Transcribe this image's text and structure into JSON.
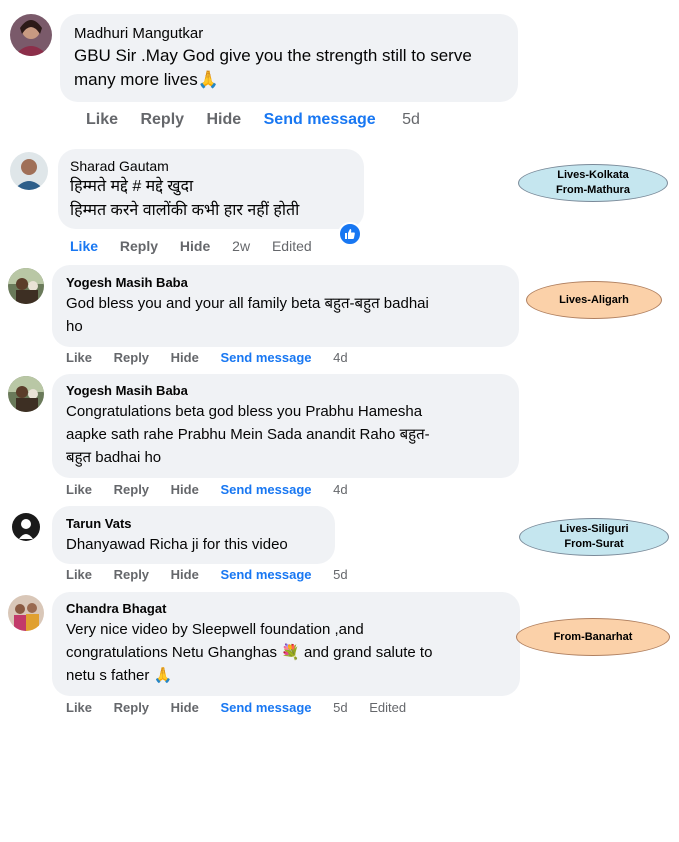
{
  "comments": [
    {
      "author": "Madhuri Mangutkar",
      "lines": [
        "GBU Sir .May God give you the strength still to serve",
        "many more lives🙏"
      ],
      "actions": {
        "like": "Like",
        "reply": "Reply",
        "hide": "Hide",
        "send": "Send message",
        "time": "5d"
      }
    },
    {
      "author": "Sharad Gautam",
      "lines": [
        "हिम्मते मद्दे # मद्दे खुदा",
        "हिम्मत करने वालोंकी कभी हार नहीं होती"
      ],
      "actions": {
        "like": "Like",
        "reply": "Reply",
        "hide": "Hide",
        "time": "2w",
        "edited": "Edited"
      }
    },
    {
      "author": "Yogesh Masih Baba",
      "lines": [
        "God bless you and your all family beta बहुत-बहुत badhai",
        "ho"
      ],
      "actions": {
        "like": "Like",
        "reply": "Reply",
        "hide": "Hide",
        "send": "Send message",
        "time": "4d"
      }
    },
    {
      "author": "Yogesh Masih Baba",
      "lines": [
        "Congratulations beta god bless you Prabhu Hamesha",
        "aapke sath rahe Prabhu Mein Sada anandit Raho बहुत-",
        "बहुत badhai ho"
      ],
      "actions": {
        "like": "Like",
        "reply": "Reply",
        "hide": "Hide",
        "send": "Send message",
        "time": "4d"
      }
    },
    {
      "author": "Tarun Vats",
      "lines": [
        "Dhanyawad Richa ji for this video"
      ],
      "actions": {
        "like": "Like",
        "reply": "Reply",
        "hide": "Hide",
        "send": "Send message",
        "time": "5d"
      }
    },
    {
      "author": "Chandra Bhagat",
      "lines": [
        "Very nice video by Sleepwell foundation ,and",
        "congratulations Netu Ghanghas 💐 and grand salute to",
        "netu s father 🙏"
      ],
      "actions": {
        "like": "Like",
        "reply": "Reply",
        "hide": "Hide",
        "send": "Send message",
        "time": "5d",
        "edited": "Edited"
      }
    }
  ],
  "tags": {
    "kolkata": [
      "Lives-Kolkata",
      "From-Mathura"
    ],
    "aligarh": [
      "Lives-Aligarh"
    ],
    "siliguri": [
      "Lives-Siliguri",
      "From-Surat"
    ],
    "banarhat": [
      "From-Banarhat"
    ]
  },
  "colors": {
    "link_blue": "#1877f2",
    "action_gray": "#65676b",
    "bubble_bg": "#f0f2f5",
    "tag_blue": "#c5e6ef",
    "tag_orange": "#fbd1a9"
  },
  "icons": {
    "reaction": "like-reaction-icon"
  }
}
